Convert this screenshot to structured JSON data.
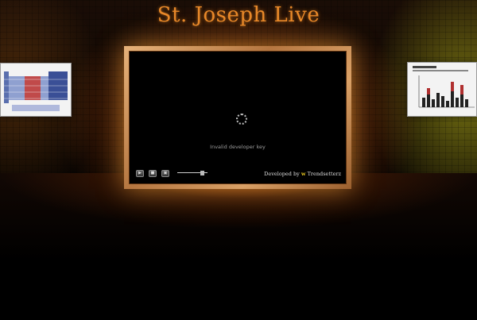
{
  "page": {
    "title": "St. Joseph Live"
  },
  "player": {
    "status_message": "Invalid developer key",
    "controls": [
      {
        "name": "play-button",
        "glyph": "▶"
      },
      {
        "name": "stop-button",
        "glyph": "■"
      },
      {
        "name": "fullscreen-button",
        "glyph": "▣"
      }
    ],
    "volume_level": 0.87,
    "credit_prefix": "Developed by",
    "credit_brand": "Trendsetterz"
  },
  "colors": {
    "title": "#e8892a",
    "glow": "#ffaa28",
    "frame": "#c98a4e"
  }
}
